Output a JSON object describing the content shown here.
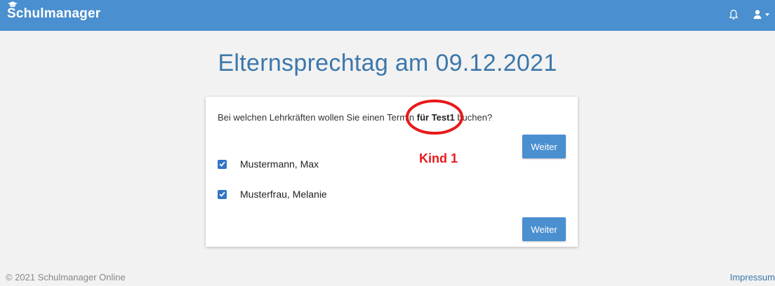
{
  "navbar": {
    "brand": "Schulmanager",
    "bell_icon": "bell-icon",
    "user_icon": "user-icon"
  },
  "page": {
    "title": "Elternsprechtag am 09.12.2021"
  },
  "form": {
    "question_before": "Bei welchen Lehrkräften wollen Sie einen Termin ",
    "question_bold": "für Test1",
    "question_after": " buchen?",
    "next_label_top": "Weiter",
    "next_label_bottom": "Weiter",
    "teachers": [
      {
        "name": "Mustermann, Max",
        "checked": true
      },
      {
        "name": "Musterfrau, Melanie",
        "checked": true
      }
    ]
  },
  "annotation": {
    "label": "Kind 1",
    "color": "#e8191a"
  },
  "footer": {
    "copyright": "© 2021 Schulmanager Online",
    "impressum": "Impressum"
  },
  "colors": {
    "primary": "#4a8fcf",
    "title": "#3b77ab",
    "checkbox": "#3274c6"
  }
}
